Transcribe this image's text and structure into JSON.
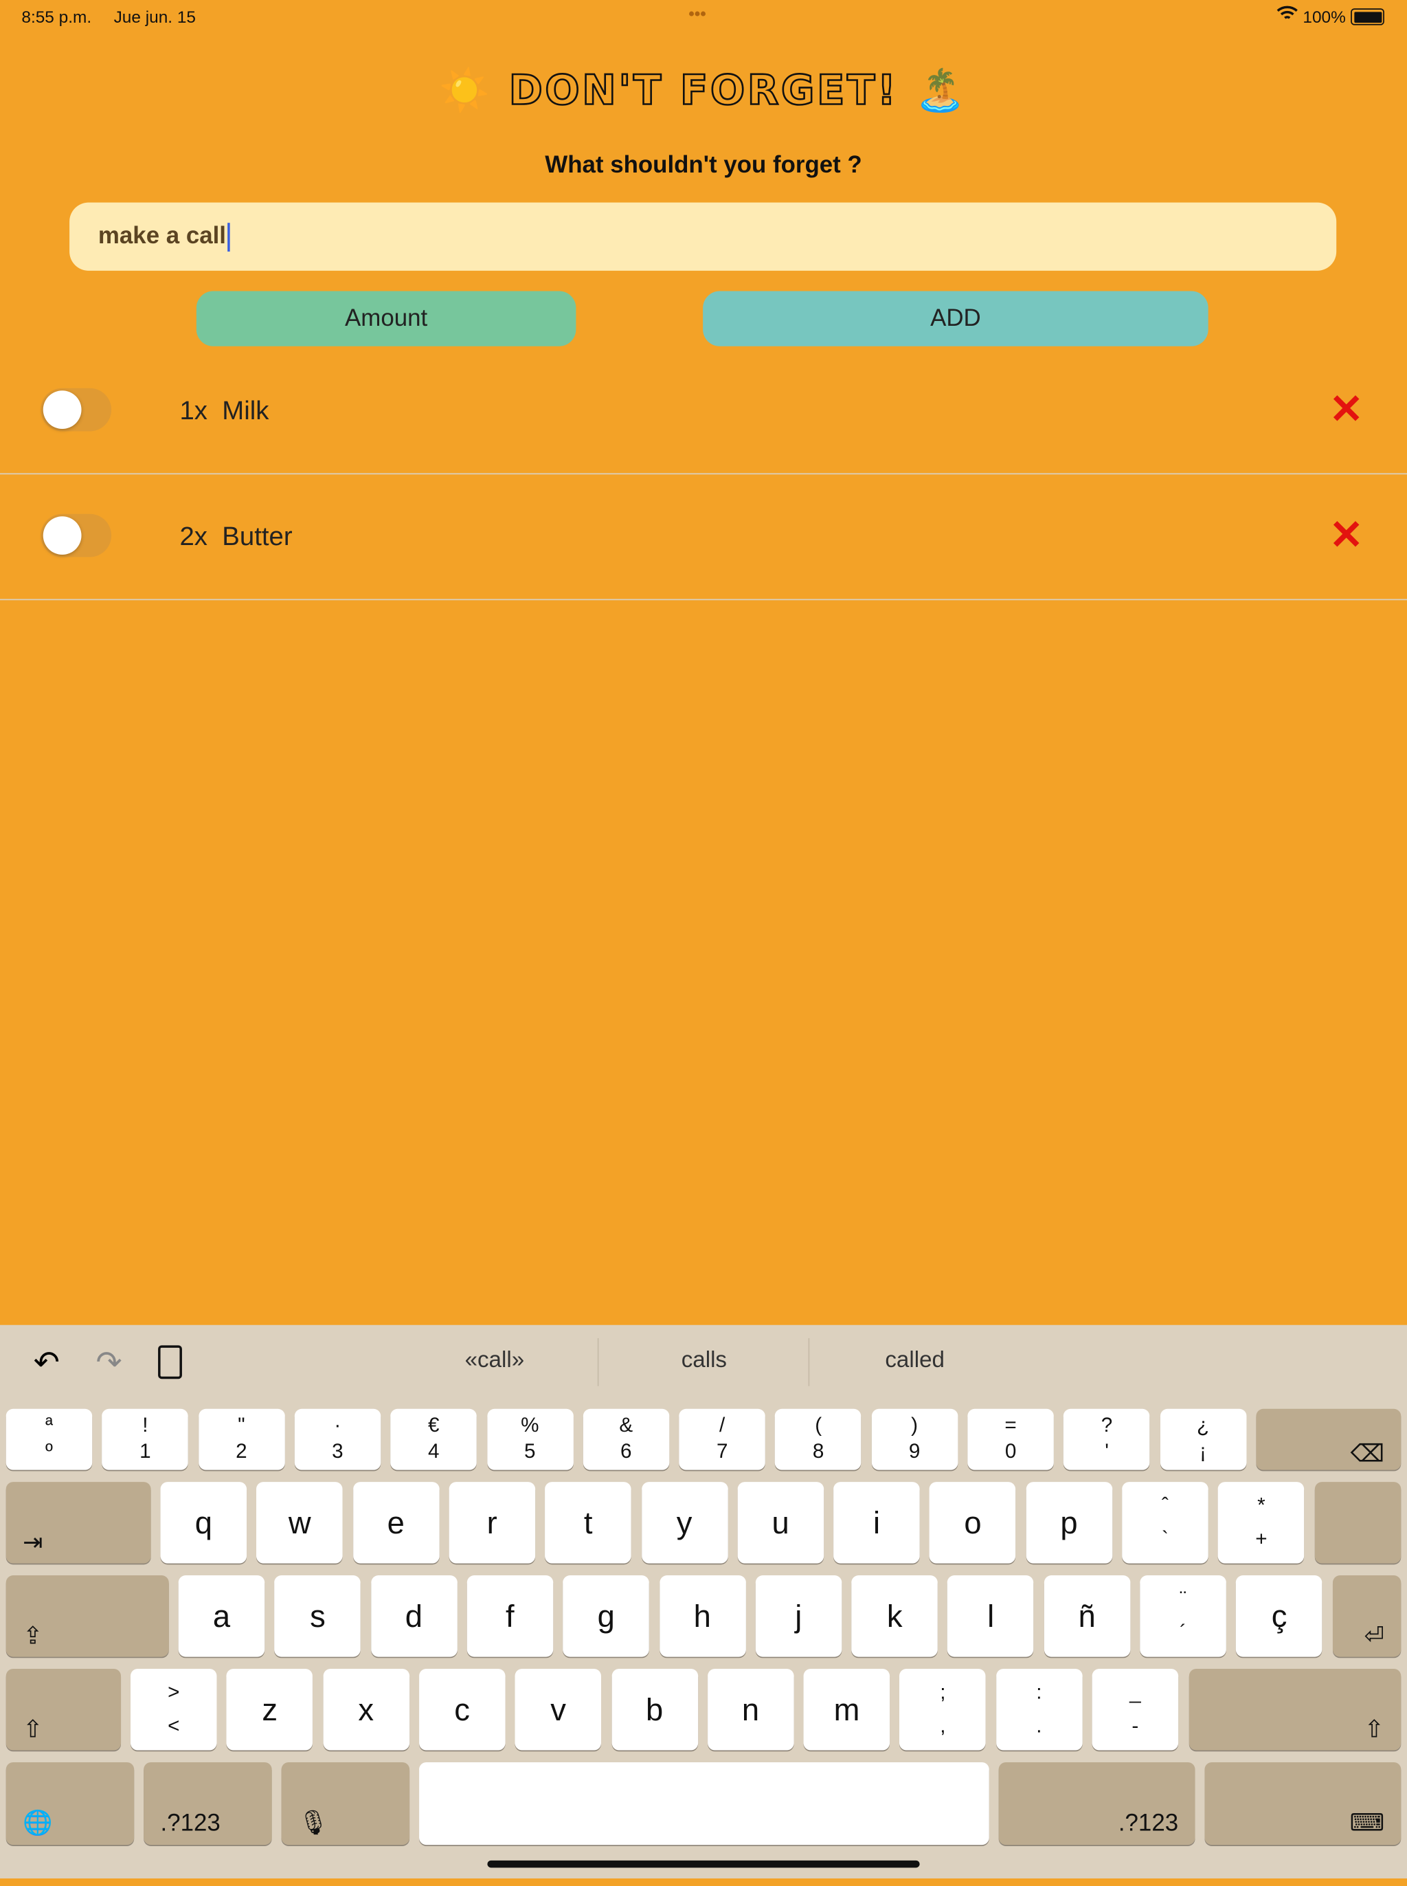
{
  "status": {
    "time": "8:55 p.m.",
    "date": "Jue jun. 15",
    "battery": "100%"
  },
  "app": {
    "title": "DON'T FORGET!",
    "title_left_emoji": "☀️",
    "title_right_emoji": "🏝️",
    "prompt": "What shouldn't you forget ?"
  },
  "input": {
    "value": "make a call"
  },
  "buttons": {
    "amount": "Amount",
    "add": "ADD"
  },
  "colors": {
    "background": "#f3a227",
    "amount_button": "#77c69c",
    "add_button": "#77c6bf",
    "delete": "#e3130f",
    "input_bg": "#feebb4"
  },
  "items": [
    {
      "qty": "1x",
      "name": "Milk",
      "checked": false
    },
    {
      "qty": "2x",
      "name": "Butter",
      "checked": false
    }
  ],
  "keyboard": {
    "suggestions": [
      "«call»",
      "calls",
      "called"
    ],
    "row1": [
      [
        "ª",
        "º"
      ],
      [
        "!",
        "1"
      ],
      [
        "\"",
        "2"
      ],
      [
        "·",
        "3"
      ],
      [
        "€",
        "4"
      ],
      [
        "%",
        "5"
      ],
      [
        "&",
        "6"
      ],
      [
        "/",
        "7"
      ],
      [
        "(",
        "8"
      ],
      [
        ")",
        "9"
      ],
      [
        "=",
        "0"
      ],
      [
        "?",
        "'"
      ],
      [
        "¿",
        "¡"
      ]
    ],
    "row2": [
      "q",
      "w",
      "e",
      "r",
      "t",
      "y",
      "u",
      "i",
      "o",
      "p",
      [
        "ˆ",
        "`"
      ],
      [
        "*",
        "+"
      ]
    ],
    "row3": [
      "a",
      "s",
      "d",
      "f",
      "g",
      "h",
      "j",
      "k",
      "l",
      "ñ",
      [
        "¨",
        "´"
      ],
      "ç"
    ],
    "row4": [
      [
        ">",
        "<"
      ],
      "z",
      "x",
      "c",
      "v",
      "b",
      "n",
      "m",
      [
        ";",
        ","
      ],
      [
        ":",
        "."
      ],
      [
        "_",
        "-"
      ]
    ],
    "numbers_label": ".?123"
  }
}
